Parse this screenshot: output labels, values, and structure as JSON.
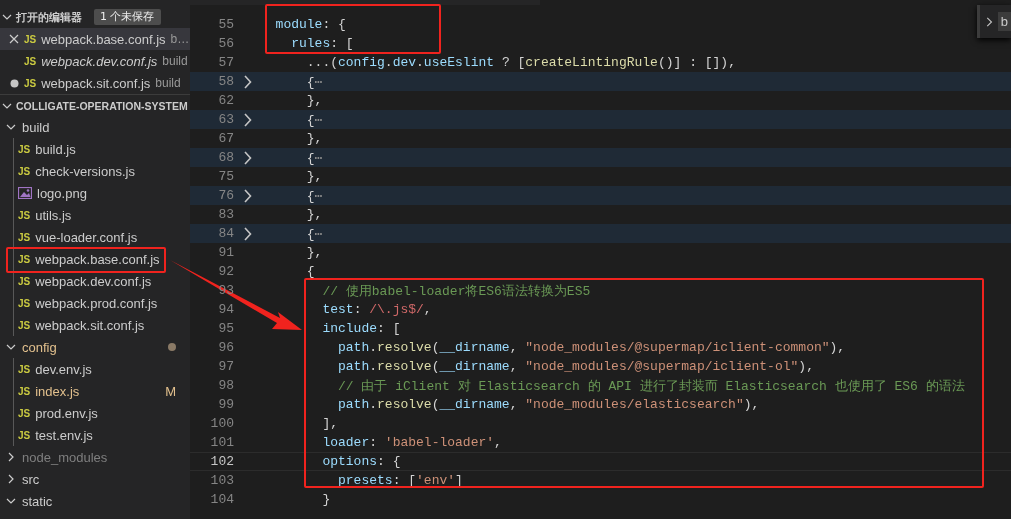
{
  "open_editors": {
    "title": "打开的编辑器",
    "badge": "1 个未保存",
    "items": [
      {
        "icon": "JS",
        "name": "webpack.base.conf.js",
        "description": "b…",
        "preview": false,
        "dirty": false,
        "selected": true
      },
      {
        "icon": "JS",
        "name": "webpack.dev.conf.js",
        "description": "build",
        "preview": true,
        "dirty": false,
        "selected": false
      },
      {
        "icon": "JS",
        "name": "webpack.sit.conf.js",
        "description": "build",
        "preview": false,
        "dirty": true,
        "selected": false
      }
    ]
  },
  "explorer": {
    "title": "COLLIGATE-OPERATION-SYSTEM",
    "expanded": true,
    "tree": [
      {
        "kind": "folder",
        "name": "build",
        "expanded": true,
        "modified": false,
        "ignored": false,
        "children": [
          {
            "kind": "file",
            "icon": "JS",
            "name": "build.js"
          },
          {
            "kind": "file",
            "icon": "JS",
            "name": "check-versions.js"
          },
          {
            "kind": "image",
            "name": "logo.png"
          },
          {
            "kind": "file",
            "icon": "JS",
            "name": "utils.js"
          },
          {
            "kind": "file",
            "icon": "JS",
            "name": "vue-loader.conf.js"
          },
          {
            "kind": "file",
            "icon": "JS",
            "name": "webpack.base.conf.js"
          },
          {
            "kind": "file",
            "icon": "JS",
            "name": "webpack.dev.conf.js"
          },
          {
            "kind": "file",
            "icon": "JS",
            "name": "webpack.prod.conf.js"
          },
          {
            "kind": "file",
            "icon": "JS",
            "name": "webpack.sit.conf.js"
          }
        ]
      },
      {
        "kind": "folder",
        "name": "config",
        "expanded": true,
        "modified": true,
        "ignored": false,
        "children": [
          {
            "kind": "file",
            "icon": "JS",
            "name": "dev.env.js"
          },
          {
            "kind": "file",
            "icon": "JS",
            "name": "index.js",
            "modified": true,
            "badge": "M"
          },
          {
            "kind": "file",
            "icon": "JS",
            "name": "prod.env.js"
          },
          {
            "kind": "file",
            "icon": "JS",
            "name": "test.env.js"
          }
        ]
      },
      {
        "kind": "folder",
        "name": "node_modules",
        "expanded": false,
        "modified": false,
        "ignored": true
      },
      {
        "kind": "folder",
        "name": "src",
        "expanded": false,
        "modified": false,
        "ignored": false
      },
      {
        "kind": "folder",
        "name": "static",
        "expanded": true,
        "modified": false,
        "ignored": false
      }
    ]
  },
  "find_widget": {
    "value": "b"
  },
  "editor": {
    "lines": [
      {
        "number": "55",
        "folded": false,
        "current": false,
        "tokens": [
          {
            "kind": "key",
            "text": "  module"
          },
          {
            "kind": "punc",
            "text": ": {"
          }
        ]
      },
      {
        "number": "56",
        "folded": false,
        "current": false,
        "tokens": [
          {
            "kind": "key",
            "text": "    rules"
          },
          {
            "kind": "punc",
            "text": ": ["
          }
        ]
      },
      {
        "number": "57",
        "folded": false,
        "current": false,
        "tokens": [
          {
            "kind": "punc",
            "text": "      ...("
          },
          {
            "kind": "var",
            "text": "config"
          },
          {
            "kind": "punc",
            "text": "."
          },
          {
            "kind": "var",
            "text": "dev"
          },
          {
            "kind": "punc",
            "text": "."
          },
          {
            "kind": "var",
            "text": "useEslint"
          },
          {
            "kind": "punc",
            "text": " ? ["
          },
          {
            "kind": "fn",
            "text": "createLintingRule"
          },
          {
            "kind": "punc",
            "text": "()] : []),"
          }
        ]
      },
      {
        "number": "58",
        "folded": true,
        "current": false,
        "tokens": [
          {
            "kind": "punc",
            "text": "      {"
          },
          {
            "kind": "fold",
            "text": "⋯"
          }
        ]
      },
      {
        "number": "62",
        "folded": false,
        "current": false,
        "tokens": [
          {
            "kind": "punc",
            "text": "      },"
          }
        ]
      },
      {
        "number": "63",
        "folded": true,
        "current": false,
        "tokens": [
          {
            "kind": "punc",
            "text": "      {"
          },
          {
            "kind": "fold",
            "text": "⋯"
          }
        ]
      },
      {
        "number": "67",
        "folded": false,
        "current": false,
        "tokens": [
          {
            "kind": "punc",
            "text": "      },"
          }
        ]
      },
      {
        "number": "68",
        "folded": true,
        "current": false,
        "tokens": [
          {
            "kind": "punc",
            "text": "      {"
          },
          {
            "kind": "fold",
            "text": "⋯"
          }
        ]
      },
      {
        "number": "75",
        "folded": false,
        "current": false,
        "tokens": [
          {
            "kind": "punc",
            "text": "      },"
          }
        ]
      },
      {
        "number": "76",
        "folded": true,
        "current": false,
        "tokens": [
          {
            "kind": "punc",
            "text": "      {"
          },
          {
            "kind": "fold",
            "text": "⋯"
          }
        ]
      },
      {
        "number": "83",
        "folded": false,
        "current": false,
        "tokens": [
          {
            "kind": "punc",
            "text": "      },"
          }
        ]
      },
      {
        "number": "84",
        "folded": true,
        "current": false,
        "tokens": [
          {
            "kind": "punc",
            "text": "      {"
          },
          {
            "kind": "fold",
            "text": "⋯"
          }
        ]
      },
      {
        "number": "91",
        "folded": false,
        "current": false,
        "tokens": [
          {
            "kind": "punc",
            "text": "      },"
          }
        ]
      },
      {
        "number": "92",
        "folded": false,
        "current": false,
        "tokens": [
          {
            "kind": "punc",
            "text": "      {"
          }
        ]
      },
      {
        "number": "93",
        "folded": false,
        "current": false,
        "tokens": [
          {
            "kind": "comment",
            "text": "        // 使用babel-loader将ES6语法转换为ES5"
          }
        ]
      },
      {
        "number": "94",
        "folded": false,
        "current": false,
        "tokens": [
          {
            "kind": "key",
            "text": "        test"
          },
          {
            "kind": "punc",
            "text": ": "
          },
          {
            "kind": "regex",
            "text": "/\\.js$/"
          },
          {
            "kind": "punc",
            "text": ","
          }
        ]
      },
      {
        "number": "95",
        "folded": false,
        "current": false,
        "tokens": [
          {
            "kind": "key",
            "text": "        include"
          },
          {
            "kind": "punc",
            "text": ": ["
          }
        ]
      },
      {
        "number": "96",
        "folded": false,
        "current": false,
        "tokens": [
          {
            "kind": "var",
            "text": "          path"
          },
          {
            "kind": "punc",
            "text": "."
          },
          {
            "kind": "fn",
            "text": "resolve"
          },
          {
            "kind": "punc",
            "text": "("
          },
          {
            "kind": "var",
            "text": "__dirname"
          },
          {
            "kind": "punc",
            "text": ", "
          },
          {
            "kind": "str",
            "text": "\"node_modules/@supermap/iclient-common\""
          },
          {
            "kind": "punc",
            "text": "),"
          }
        ]
      },
      {
        "number": "97",
        "folded": false,
        "current": false,
        "tokens": [
          {
            "kind": "var",
            "text": "          path"
          },
          {
            "kind": "punc",
            "text": "."
          },
          {
            "kind": "fn",
            "text": "resolve"
          },
          {
            "kind": "punc",
            "text": "("
          },
          {
            "kind": "var",
            "text": "__dirname"
          },
          {
            "kind": "punc",
            "text": ", "
          },
          {
            "kind": "str",
            "text": "\"node_modules/@supermap/iclient-ol\""
          },
          {
            "kind": "punc",
            "text": "),"
          }
        ]
      },
      {
        "number": "98",
        "folded": false,
        "current": false,
        "tokens": [
          {
            "kind": "comment",
            "text": "          // 由于 iClient 对 Elasticsearch 的 API 进行了封装而 Elasticsearch 也使用了 ES6 的语法"
          }
        ]
      },
      {
        "number": "99",
        "folded": false,
        "current": false,
        "tokens": [
          {
            "kind": "var",
            "text": "          path"
          },
          {
            "kind": "punc",
            "text": "."
          },
          {
            "kind": "fn",
            "text": "resolve"
          },
          {
            "kind": "punc",
            "text": "("
          },
          {
            "kind": "var",
            "text": "__dirname"
          },
          {
            "kind": "punc",
            "text": ", "
          },
          {
            "kind": "str",
            "text": "\"node_modules/elasticsearch\""
          },
          {
            "kind": "punc",
            "text": "),"
          }
        ]
      },
      {
        "number": "100",
        "folded": false,
        "current": false,
        "tokens": [
          {
            "kind": "punc",
            "text": "        ],"
          }
        ]
      },
      {
        "number": "101",
        "folded": false,
        "current": false,
        "tokens": [
          {
            "kind": "key",
            "text": "        loader"
          },
          {
            "kind": "punc",
            "text": ": "
          },
          {
            "kind": "str",
            "text": "'babel-loader'"
          },
          {
            "kind": "punc",
            "text": ","
          }
        ]
      },
      {
        "number": "102",
        "folded": false,
        "current": true,
        "tokens": [
          {
            "kind": "key",
            "text": "        options"
          },
          {
            "kind": "punc",
            "text": ": {"
          }
        ]
      },
      {
        "number": "103",
        "folded": false,
        "current": false,
        "tokens": [
          {
            "kind": "key",
            "text": "          presets"
          },
          {
            "kind": "punc",
            "text": ": ["
          },
          {
            "kind": "str",
            "text": "'env'"
          },
          {
            "kind": "punc",
            "text": "]"
          }
        ]
      },
      {
        "number": "104",
        "folded": false,
        "current": false,
        "tokens": [
          {
            "kind": "punc",
            "text": "        }"
          }
        ]
      }
    ]
  }
}
